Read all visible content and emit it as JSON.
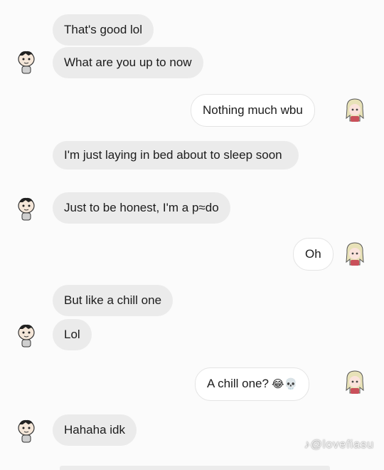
{
  "messages": [
    {
      "id": "m1",
      "side": "received",
      "text": "That's good lol"
    },
    {
      "id": "m2",
      "side": "received",
      "text": "What are you up to now"
    },
    {
      "id": "m3",
      "side": "sent",
      "text": "Nothing much wbu"
    },
    {
      "id": "m4",
      "side": "received",
      "text": "I'm just laying in bed about to sleep soon"
    },
    {
      "id": "m5",
      "side": "received",
      "text": "Just to be honest, I'm a p≈do"
    },
    {
      "id": "m6",
      "side": "sent",
      "text": "Oh"
    },
    {
      "id": "m7",
      "side": "received",
      "text": "But like a chill one"
    },
    {
      "id": "m8",
      "side": "received",
      "text": "Lol"
    },
    {
      "id": "m9",
      "side": "sent",
      "text": "A chill one?",
      "emojis": "😂💀"
    },
    {
      "id": "m10",
      "side": "received",
      "text": "Hahaha idk"
    }
  ],
  "avatars": {
    "received": "cartoon-boy-avatar-icon",
    "sent": "anime-girl-avatar-icon"
  },
  "watermark": "♪@lovefiasu",
  "colors": {
    "received_bubble": "#ebebeb",
    "sent_bubble": "#ffffff",
    "background": "#fbfbfb"
  }
}
